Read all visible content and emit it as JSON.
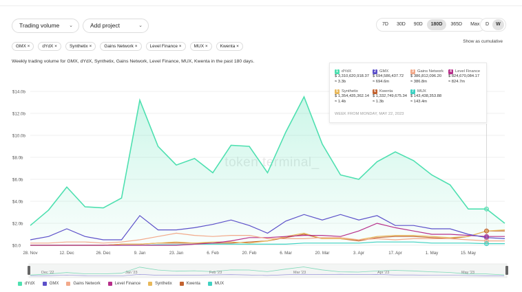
{
  "controls": {
    "metric_select": "Trading volume",
    "project_select": "Add project",
    "time_ranges": [
      "7D",
      "30D",
      "90D",
      "180D",
      "365D",
      "Max"
    ],
    "active_range": "180D",
    "granularity": [
      "D",
      "W"
    ],
    "active_granularity": "W",
    "cumulative_label": "Show as cumulative"
  },
  "chips": [
    "GMX ×",
    "dYdX ×",
    "Synthetix ×",
    "Gains Network ×",
    "Level Finance ×",
    "MUX ×",
    "Kwenta ×"
  ],
  "subtitle": "Weekly trading volume for GMX, dYdX, Synthetix, Gains Network, Level Finance, MUX, Kwenta in the past 180 days.",
  "watermark": "token terminal_",
  "tooltip": {
    "week": "WEEK FROM MONDAY, MAY 22, 2023",
    "items": [
      {
        "n": "1",
        "name": "dYdX",
        "value": "$ 3,310,620,918.37",
        "short": "≈ 3.3b",
        "color": "#4ee0b0"
      },
      {
        "n": "2",
        "name": "GMX",
        "value": "$ 694,586,437.72",
        "short": "≈ 694.6m",
        "color": "#5b4fc9"
      },
      {
        "n": "3",
        "name": "Gains Network",
        "value": "$ 386,812,096.20",
        "short": "≈ 386.8m",
        "color": "#f2a98a"
      },
      {
        "n": "4",
        "name": "Level Finance",
        "value": "$ 824,670,084.17",
        "short": "≈ 824.7m",
        "color": "#b62e8a"
      },
      {
        "n": "5",
        "name": "Synthetix",
        "value": "$ 1,354,435,362.14",
        "short": "≈ 1.4b",
        "color": "#e8b85a"
      },
      {
        "n": "6",
        "name": "Kwenta",
        "value": "$ 1,332,749,675.34",
        "short": "≈ 1.3b",
        "color": "#c2622f"
      },
      {
        "n": "7",
        "name": "MUX",
        "value": "$ 143,438,353.88",
        "short": "≈ 143.4m",
        "color": "#3fd1c2"
      }
    ]
  },
  "chart_data": {
    "type": "area",
    "x_ticks": [
      "28. Nov",
      "12. Dec",
      "26. Dec",
      "9. Jan",
      "23. Jan",
      "6. Feb",
      "20. Feb",
      "6. Mar",
      "20. Mar",
      "3. Apr",
      "17. Apr",
      "1. May",
      "15. May"
    ],
    "navigator_ticks": [
      "Dec '22",
      "Jan '23",
      "Feb '23",
      "Mar '23",
      "Apr '23",
      "May '23"
    ],
    "y_ticks": [
      "$0.0",
      "$2.0b",
      "$4.0b",
      "$6.0b",
      "$8.0b",
      "$10.0b",
      "$12.0b",
      "$14.0b"
    ],
    "ylim": [
      0,
      14
    ],
    "unit": "billions USD",
    "series": [
      {
        "name": "dYdX",
        "color": "#4ee0b0",
        "values": [
          1.8,
          3.2,
          5.3,
          3.5,
          3.4,
          4.3,
          13.2,
          9.0,
          7.3,
          7.9,
          6.6,
          9.1,
          9.0,
          6.6,
          10.3,
          13.5,
          9.2,
          6.4,
          6.0,
          7.6,
          8.5,
          7.7,
          6.4,
          5.5,
          3.3,
          3.3,
          2.0
        ]
      },
      {
        "name": "GMX",
        "color": "#5b4fc9",
        "values": [
          0.5,
          0.8,
          1.5,
          0.8,
          0.5,
          0.5,
          2.7,
          1.4,
          1.4,
          1.6,
          1.9,
          2.3,
          1.8,
          1.1,
          2.2,
          2.8,
          2.3,
          2.8,
          2.3,
          2.7,
          1.8,
          1.8,
          1.5,
          1.5,
          1.0,
          0.7,
          0.6
        ]
      },
      {
        "name": "Gains Network",
        "color": "#f2a98a",
        "values": [
          0.2,
          0.2,
          0.3,
          0.3,
          0.2,
          0.3,
          0.5,
          0.8,
          1.1,
          0.9,
          0.8,
          0.9,
          0.9,
          0.6,
          0.6,
          0.6,
          0.7,
          0.7,
          0.5,
          0.6,
          0.5,
          0.6,
          0.6,
          0.6,
          0.5,
          0.4,
          0.4
        ]
      },
      {
        "name": "Level Finance",
        "color": "#b62e8a",
        "values": [
          0.0,
          0.0,
          0.0,
          0.0,
          0.0,
          0.0,
          0.0,
          0.0,
          0.0,
          0.1,
          0.2,
          0.4,
          0.7,
          0.7,
          0.8,
          0.9,
          0.9,
          0.8,
          1.3,
          2.0,
          1.6,
          1.3,
          1.0,
          1.0,
          0.9,
          0.8,
          0.8
        ]
      },
      {
        "name": "Synthetix",
        "color": "#e8b85a",
        "values": [
          0.0,
          0.0,
          0.0,
          0.0,
          0.0,
          0.1,
          0.1,
          0.2,
          0.3,
          0.2,
          0.3,
          0.3,
          0.2,
          0.4,
          0.8,
          1.1,
          0.6,
          0.6,
          0.5,
          0.8,
          0.9,
          0.9,
          0.8,
          0.7,
          0.8,
          1.3,
          1.4
        ]
      },
      {
        "name": "Kwenta",
        "color": "#c2622f",
        "values": [
          0.0,
          0.0,
          0.0,
          0.0,
          0.0,
          0.1,
          0.1,
          0.2,
          0.2,
          0.2,
          0.2,
          0.2,
          0.3,
          0.4,
          0.7,
          1.0,
          0.6,
          0.6,
          0.4,
          0.7,
          0.8,
          0.8,
          0.7,
          0.6,
          0.8,
          1.3,
          1.3
        ]
      },
      {
        "name": "MUX",
        "color": "#3fd1c2",
        "values": [
          0.0,
          0.0,
          0.0,
          0.0,
          0.0,
          0.0,
          0.0,
          0.05,
          0.05,
          0.1,
          0.1,
          0.1,
          0.1,
          0.1,
          0.1,
          0.2,
          0.2,
          0.2,
          0.2,
          0.3,
          0.3,
          0.3,
          0.2,
          0.2,
          0.2,
          0.15,
          0.15
        ]
      }
    ],
    "legend": [
      "dYdX",
      "GMX",
      "Gains Network",
      "Level Finance",
      "Synthetix",
      "Kwenta",
      "MUX"
    ],
    "legend_position": "bottom-left",
    "grid": true
  }
}
